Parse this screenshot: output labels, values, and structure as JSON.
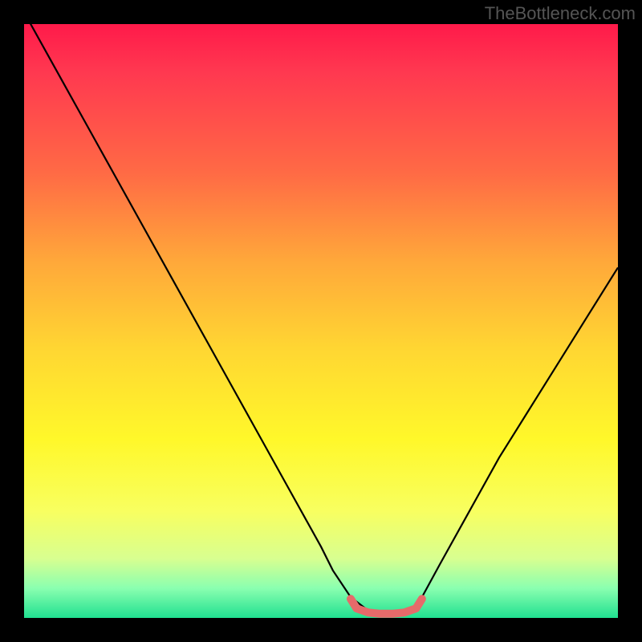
{
  "attribution": "TheBottleneck.com",
  "chart_data": {
    "type": "line",
    "title": "",
    "xlabel": "",
    "ylabel": "",
    "xlim": [
      0,
      100
    ],
    "ylim": [
      0,
      100
    ],
    "series": [
      {
        "name": "bottleneck-curve",
        "x": [
          0,
          5,
          10,
          15,
          20,
          25,
          30,
          35,
          40,
          45,
          50,
          52,
          55,
          58,
          60,
          62,
          65,
          67,
          70,
          75,
          80,
          85,
          90,
          95,
          100
        ],
        "y": [
          102,
          93,
          84,
          75,
          66,
          57,
          48,
          39,
          30,
          21,
          12,
          8,
          3.5,
          1.2,
          0.8,
          0.8,
          1.2,
          3.5,
          9,
          18,
          27,
          35,
          43,
          51,
          59
        ]
      },
      {
        "name": "optimal-zone",
        "x": [
          55,
          56,
          58,
          60,
          62,
          64,
          66,
          67
        ],
        "y": [
          3.2,
          1.6,
          0.9,
          0.7,
          0.7,
          0.9,
          1.6,
          3.2
        ]
      }
    ],
    "colors": {
      "curve": "#000000",
      "optimal": "#e66a6a"
    }
  }
}
